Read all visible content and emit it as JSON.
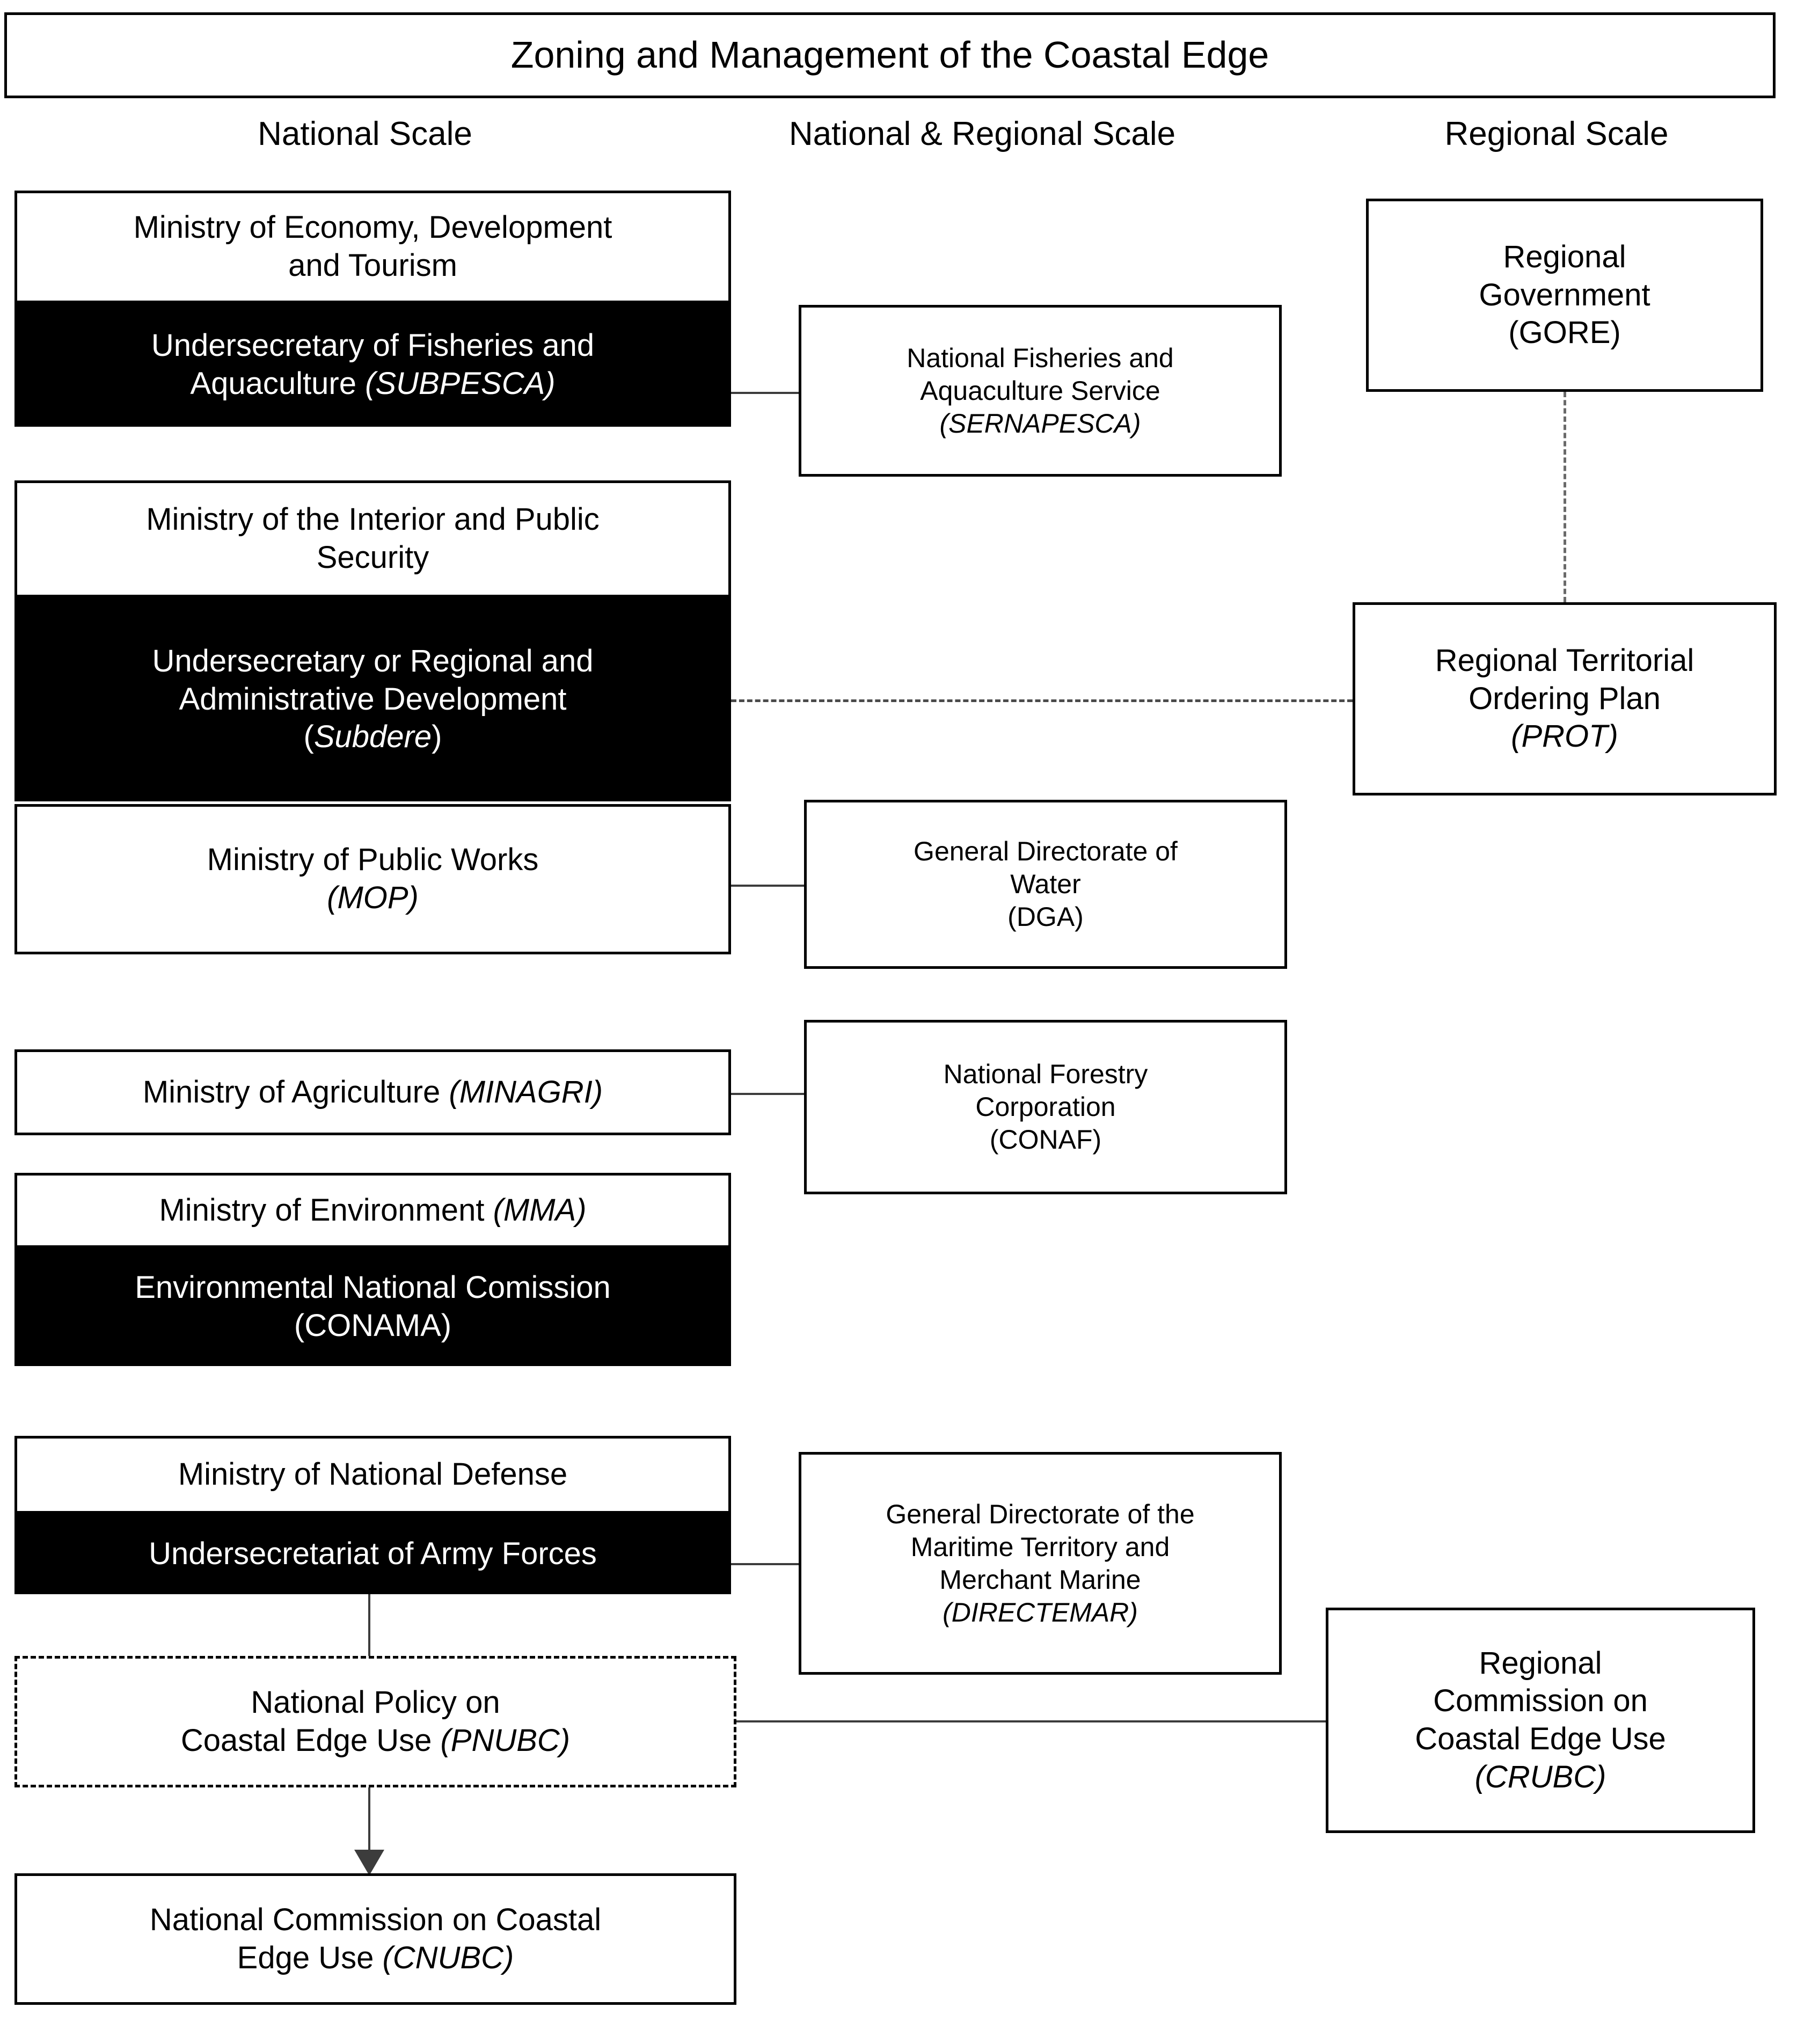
{
  "title": "Zoning and Management of the Coastal Edge",
  "column_headers": {
    "national": "National Scale",
    "national_regional": "National & Regional Scale",
    "regional": "Regional Scale"
  },
  "boxes": {
    "economy": {
      "line1": "Ministry of Economy, Development",
      "line2": "and Tourism"
    },
    "subpesca": {
      "line1": "Undersecretary of Fisheries and",
      "line2": "Aquaculture ",
      "acronym": "(SUBPESCA)"
    },
    "interior": {
      "line1": "Ministry of the  Interior and Public",
      "line2": "Security"
    },
    "subdere": {
      "line1": "Undersecretary or Regional and",
      "line2": "Administrative Development",
      "acronym_open": "(",
      "acronym": "Subdere",
      "acronym_close": ")"
    },
    "mop": {
      "line1": "Ministry of Public Works",
      "acronym": "(MOP)"
    },
    "minagri": {
      "line1": "Ministry of Agriculture ",
      "acronym": "(MINAGRI)"
    },
    "mma": {
      "line1": "Ministry of Environment ",
      "acronym": "(MMA)"
    },
    "conama": {
      "line1": "Environmental National Comission",
      "line2": "(CONAMA)"
    },
    "defense": {
      "line1": "Ministry of National Defense"
    },
    "army": {
      "line1": "Undersecretariat of Army Forces"
    },
    "pnubc": {
      "line1": "National Policy on",
      "line2": "Coastal Edge Use ",
      "acronym": "(PNUBC)"
    },
    "cnubc": {
      "line1": "National Commission on Coastal",
      "line2": "Edge Use ",
      "acronym": "(CNUBC)"
    },
    "sernapesca": {
      "line1": "National Fisheries and",
      "line2": "Aquaculture Service",
      "acronym": "(SERNAPESCA)"
    },
    "dga": {
      "line1": "General  Directorate of",
      "line2": "Water",
      "line3": "(DGA)"
    },
    "conaf": {
      "line1": "National  Forestry",
      "line2": "Corporation",
      "line3": "(CONAF)"
    },
    "directemar": {
      "line1": "General Directorate of the",
      "line2": "Maritime  Territory and",
      "line3": "Merchant Marine",
      "acronym": "(DIRECTEMAR)"
    },
    "gore": {
      "line1": "Regional",
      "line2": "Government",
      "line3": "(GORE)"
    },
    "prot": {
      "line1": "Regional Territorial",
      "line2": "Ordering Plan",
      "acronym": "(PROT)"
    },
    "crubc": {
      "line1": "Regional",
      "line2": "Commission on",
      "line3": "Coastal Edge Use",
      "acronym": "(CRUBC)"
    }
  },
  "colors": {
    "highlight_fill": "#000000",
    "highlight_text": "#ffffff",
    "box_fill": "#ffffff",
    "box_border": "#000000",
    "connector": "#3c3c3c"
  }
}
